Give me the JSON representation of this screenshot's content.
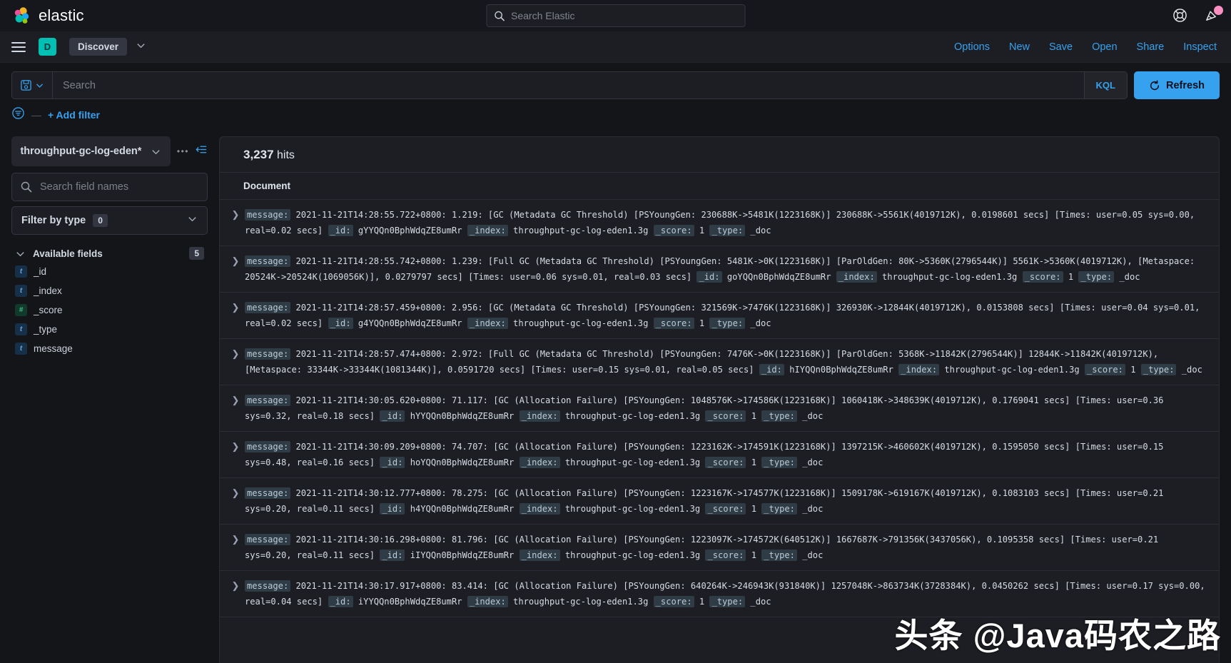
{
  "topbar": {
    "brand": "elastic",
    "global_search_placeholder": "Search Elastic",
    "help_icon": "help-lifebuoy-icon",
    "announcement_icon": "announcement-megaphone-icon"
  },
  "appnav": {
    "space_initial": "D",
    "app_name": "Discover",
    "links": [
      "Options",
      "New",
      "Save",
      "Open",
      "Share",
      "Inspect"
    ]
  },
  "querybar": {
    "saved_query_icon": "save-disk-icon",
    "query_value": "",
    "query_placeholder": "Search",
    "language": "KQL",
    "refresh_label": "Refresh",
    "refresh_icon": "refresh-icon",
    "add_filter_label": "+ Add filter",
    "filter_icon": "filter-icon",
    "filter_dash": "—"
  },
  "sidebar": {
    "index_pattern": "throughput-gc-log-eden*",
    "more_icon": "more-options-icon",
    "collapse_icon": "collapse-sidebar-icon",
    "field_search_placeholder": "Search field names",
    "search_icon": "search-icon",
    "filter_by_type_label": "Filter by type",
    "filter_by_type_count": "0",
    "available_fields_label": "Available fields",
    "available_fields_count": "5",
    "fields": [
      {
        "name": "_id",
        "type": "t"
      },
      {
        "name": "_index",
        "type": "t"
      },
      {
        "name": "_score",
        "type": "#"
      },
      {
        "name": "_type",
        "type": "t"
      },
      {
        "name": "message",
        "type": "t"
      }
    ]
  },
  "main": {
    "hits_count": "3,237",
    "hits_word": "hits",
    "column_header": "Document",
    "documents": [
      {
        "message": "2021-11-21T14:28:55.722+0800: 1.219: [GC (Metadata GC Threshold) [PSYoungGen: 230688K->5481K(1223168K)] 230688K->5561K(4019712K), 0.0198601 secs] [Times: user=0.05 sys=0.00, real=0.02 secs]",
        "_id": "gYYQQn0BphWdqZE8umRr",
        "_index": "throughput-gc-log-eden1.3g",
        "_score": "1",
        "_type": "_doc"
      },
      {
        "message": "2021-11-21T14:28:55.742+0800: 1.239: [Full GC (Metadata GC Threshold) [PSYoungGen: 5481K->0K(1223168K)] [ParOldGen: 80K->5360K(2796544K)] 5561K->5360K(4019712K), [Metaspace: 20524K->20524K(1069056K)], 0.0279797 secs] [Times: user=0.06 sys=0.01, real=0.03 secs]",
        "_id": "goYQQn0BphWdqZE8umRr",
        "_index": "throughput-gc-log-eden1.3g",
        "_score": "1",
        "_type": "_doc"
      },
      {
        "message": "2021-11-21T14:28:57.459+0800: 2.956: [GC (Metadata GC Threshold) [PSYoungGen: 321569K->7476K(1223168K)] 326930K->12844K(4019712K), 0.0153808 secs] [Times: user=0.04 sys=0.01, real=0.02 secs]",
        "_id": "g4YQQn0BphWdqZE8umRr",
        "_index": "throughput-gc-log-eden1.3g",
        "_score": "1",
        "_type": "_doc"
      },
      {
        "message": "2021-11-21T14:28:57.474+0800: 2.972: [Full GC (Metadata GC Threshold) [PSYoungGen: 7476K->0K(1223168K)] [ParOldGen: 5368K->11842K(2796544K)] 12844K->11842K(4019712K), [Metaspace: 33344K->33344K(1081344K)], 0.0591720 secs] [Times: user=0.15 sys=0.01, real=0.05 secs]",
        "_id": "hIYQQn0BphWdqZE8umRr",
        "_index": "throughput-gc-log-eden1.3g",
        "_score": "1",
        "_type": "_doc"
      },
      {
        "message": "2021-11-21T14:30:05.620+0800: 71.117: [GC (Allocation Failure) [PSYoungGen: 1048576K->174586K(1223168K)] 1060418K->348639K(4019712K), 0.1769041 secs] [Times: user=0.36 sys=0.32, real=0.18 secs]",
        "_id": "hYYQQn0BphWdqZE8umRr",
        "_index": "throughput-gc-log-eden1.3g",
        "_score": "1",
        "_type": "_doc"
      },
      {
        "message": "2021-11-21T14:30:09.209+0800: 74.707: [GC (Allocation Failure) [PSYoungGen: 1223162K->174591K(1223168K)] 1397215K->460602K(4019712K), 0.1595050 secs] [Times: user=0.15 sys=0.48, real=0.16 secs]",
        "_id": "hoYQQn0BphWdqZE8umRr",
        "_index": "throughput-gc-log-eden1.3g",
        "_score": "1",
        "_type": "_doc"
      },
      {
        "message": "2021-11-21T14:30:12.777+0800: 78.275: [GC (Allocation Failure) [PSYoungGen: 1223167K->174577K(1223168K)] 1509178K->619167K(4019712K), 0.1083103 secs] [Times: user=0.21 sys=0.20, real=0.11 secs]",
        "_id": "h4YQQn0BphWdqZE8umRr",
        "_index": "throughput-gc-log-eden1.3g",
        "_score": "1",
        "_type": "_doc"
      },
      {
        "message": "2021-11-21T14:30:16.298+0800: 81.796: [GC (Allocation Failure) [PSYoungGen: 1223097K->174572K(640512K)] 1667687K->791356K(3437056K), 0.1095358 secs] [Times: user=0.21 sys=0.20, real=0.11 secs]",
        "_id": "iIYQQn0BphWdqZE8umRr",
        "_index": "throughput-gc-log-eden1.3g",
        "_score": "1",
        "_type": "_doc"
      },
      {
        "message": "2021-11-21T14:30:17.917+0800: 83.414: [GC (Allocation Failure) [PSYoungGen: 640264K->246943K(931840K)] 1257048K->863734K(3728384K), 0.0450262 secs] [Times: user=0.17 sys=0.00, real=0.04 secs]",
        "_id": "iYYQQn0BphWdqZE8umRr",
        "_index": "throughput-gc-log-eden1.3g",
        "_score": "1",
        "_type": "_doc"
      }
    ],
    "field_labels": {
      "message": "message:",
      "id": "_id:",
      "index": "_index:",
      "score": "_score:",
      "type": "_type:"
    }
  },
  "watermark": "头条 @Java码农之路",
  "colors": {
    "accent": "#36a2ef",
    "brand_teal": "#00bfb3",
    "badge_pink": "#f990c1",
    "background": "#141519",
    "panel": "#1d1e24"
  }
}
